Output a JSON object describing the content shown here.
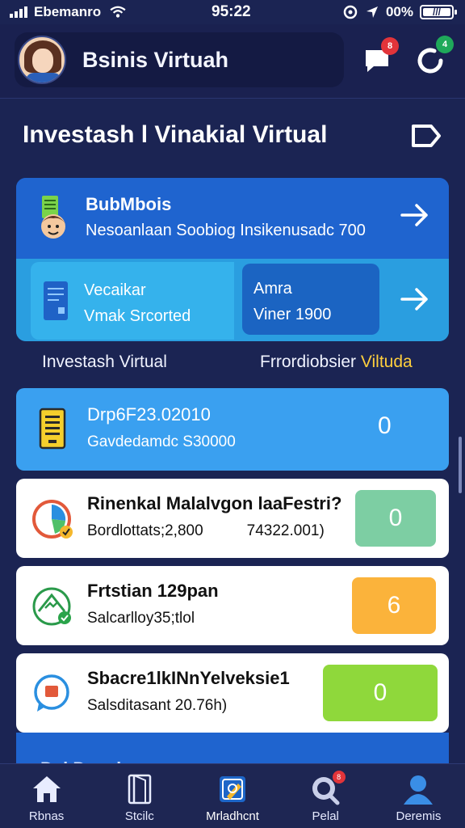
{
  "status": {
    "carrier": "Ebemanro",
    "time": "95:22",
    "battery": "00%"
  },
  "header": {
    "title": "Bsinis Virtuah",
    "chat_badge": "8",
    "refresh_badge": "4"
  },
  "section": {
    "title": "Investash l Vinakial Virtual"
  },
  "hero": {
    "top_title": "BubMbois",
    "top_subtitle": "Nesoanlaan Soobiog Insikenusadc 700",
    "left_title": "Vecaikar",
    "left_subtitle": "Vmak Srcorted",
    "right_title": "Amra",
    "right_subtitle": "Viner 1900"
  },
  "captions": {
    "left": "Investash Virtual",
    "right_main": "Frrordiobsier ",
    "right_accent": "Viltuda"
  },
  "list": [
    {
      "title": "Drp6F23.02010",
      "subtitle": "Gavdedamdc S30000",
      "value": "0"
    },
    {
      "title": "Rinenkal Malalvgon laaFestri?",
      "subtitle_a": "Bordlottats;2,800",
      "subtitle_b": "74322.001)",
      "value": "0"
    },
    {
      "title": "Frtstian 129pan",
      "subtitle": "Salcarlloy35;tlol",
      "value": "6"
    },
    {
      "title": "Sbacre1lkINnYelveksie1",
      "subtitle": "Salsditasant 20.76h)",
      "value": "0"
    }
  ],
  "peek": {
    "text": "Del Dnevlnes"
  },
  "nav": [
    {
      "label": "Rbnas",
      "icon": "home-icon"
    },
    {
      "label": "Stcilc",
      "icon": "book-icon"
    },
    {
      "label": "Mrladhcnt",
      "icon": "pencil-icon"
    },
    {
      "label": "Pelal",
      "icon": "search-icon",
      "badge": "8"
    },
    {
      "label": "Deremis",
      "icon": "person-icon"
    }
  ],
  "colors": {
    "background": "#1b2453",
    "accent_blue": "#3aa0f0",
    "green_box": "#7dcea3",
    "orange_box": "#fbb33b",
    "lime_box": "#8fd83b"
  }
}
